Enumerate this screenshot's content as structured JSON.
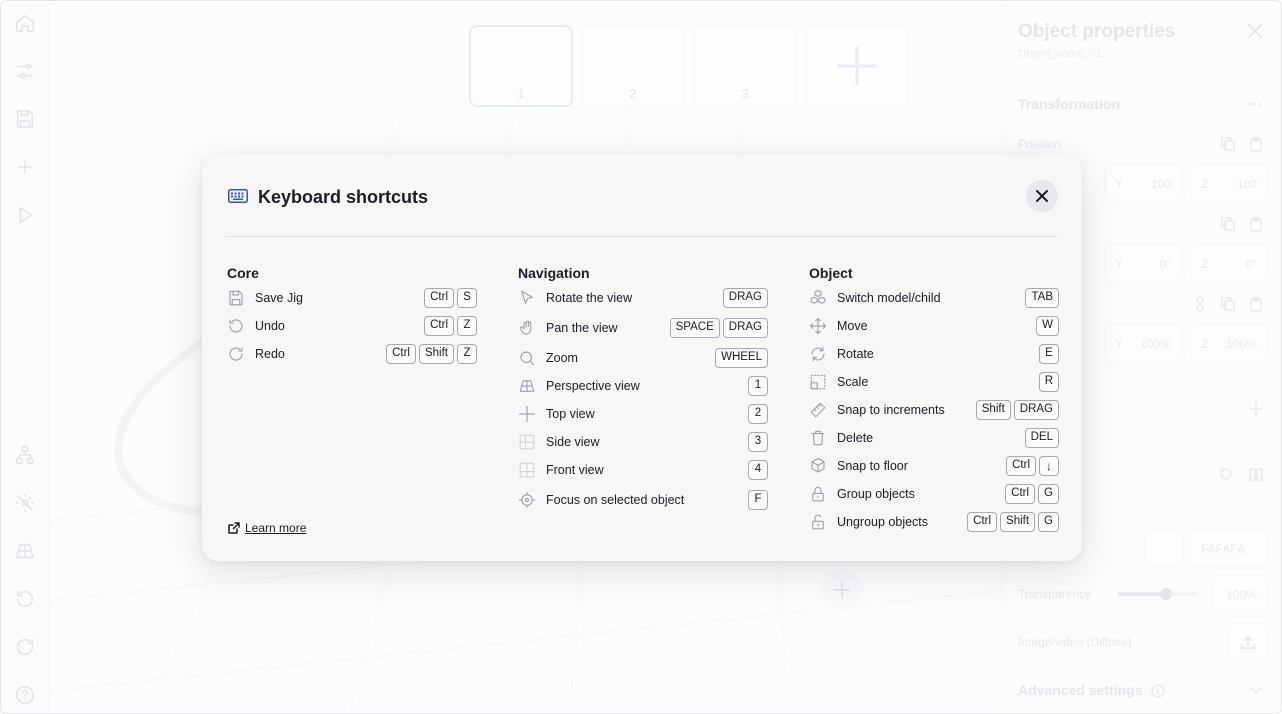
{
  "views": {
    "items": [
      "1",
      "2",
      "3"
    ],
    "active": "1"
  },
  "panel": {
    "title": "Object properties",
    "object_name": "Object_name_01",
    "transformation_title": "Transformation",
    "position_label": "Position",
    "position": {
      "y_axis": "Y",
      "y_value": "100",
      "z_axis": "Z",
      "z_value": "100"
    },
    "rotation": {
      "y_axis": "Y",
      "y_value": "0°",
      "z_axis": "Z",
      "z_value": "0°"
    },
    "scale": {
      "y_axis": "Y",
      "y_value": "100%",
      "z_axis": "Z",
      "z_value": "100%"
    },
    "color_hex": "FAFAFA",
    "transparency_label": "Transparency",
    "transparency_value": "100%",
    "transparency_level": 0.6,
    "diffuse_label": "Image/video (Diffuse)",
    "advanced_label": "Advanced settings"
  },
  "dialog": {
    "title": "Keyboard shortcuts",
    "learn_more": "Learn more",
    "accent_color": "#3b4cc7",
    "columns": {
      "core": {
        "title": "Core",
        "items": [
          {
            "icon": "save-icon",
            "label": "Save Jig",
            "keys": [
              "Ctrl",
              "S"
            ]
          },
          {
            "icon": "undo-icon",
            "label": "Undo",
            "keys": [
              "Ctrl",
              "Z"
            ]
          },
          {
            "icon": "redo-icon",
            "label": "Redo",
            "keys": [
              "Ctrl",
              "Shift",
              "Z"
            ]
          }
        ]
      },
      "navigation": {
        "title": "Navigation",
        "items": [
          {
            "icon": "cursor-icon",
            "label": "Rotate the view",
            "keys": [
              "DRAG"
            ]
          },
          {
            "icon": "hand-icon",
            "label": "Pan the view",
            "keys": [
              "SPACE",
              "DRAG"
            ]
          },
          {
            "icon": "magnifier-icon",
            "label": "Zoom",
            "keys": [
              "WHEEL"
            ]
          },
          {
            "icon": "perspective-icon",
            "label": "Perspective view",
            "keys": [
              "1"
            ]
          },
          {
            "icon": "top-view-icon",
            "label": "Top view",
            "keys": [
              "2"
            ]
          },
          {
            "icon": "side-view-icon",
            "label": "Side view",
            "keys": [
              "3"
            ]
          },
          {
            "icon": "front-view-icon",
            "label": "Front view",
            "keys": [
              "4"
            ]
          },
          {
            "icon": "focus-icon",
            "label": "Focus on selected object",
            "keys": [
              "F"
            ]
          }
        ]
      },
      "object": {
        "title": "Object",
        "items": [
          {
            "icon": "cubes-icon",
            "label": "Switch model/child",
            "keys": [
              "TAB"
            ]
          },
          {
            "icon": "move-icon",
            "label": "Move",
            "keys": [
              "W"
            ]
          },
          {
            "icon": "rotate-icon",
            "label": "Rotate",
            "keys": [
              "E"
            ]
          },
          {
            "icon": "scale-icon",
            "label": "Scale",
            "keys": [
              "R"
            ]
          },
          {
            "icon": "ruler-icon",
            "label": "Snap to increments",
            "keys": [
              "Shift",
              "DRAG"
            ]
          },
          {
            "icon": "trash-icon",
            "label": "Delete",
            "keys": [
              "DEL"
            ]
          },
          {
            "icon": "cube-floor-icon",
            "label": "Snap to floor",
            "keys": [
              "Ctrl",
              "↓"
            ]
          },
          {
            "icon": "lock-icon",
            "label": "Group objects",
            "keys": [
              "Ctrl",
              "G"
            ]
          },
          {
            "icon": "unlock-icon",
            "label": "Ungroup objects",
            "keys": [
              "Ctrl",
              "Shift",
              "G"
            ]
          }
        ]
      }
    }
  }
}
